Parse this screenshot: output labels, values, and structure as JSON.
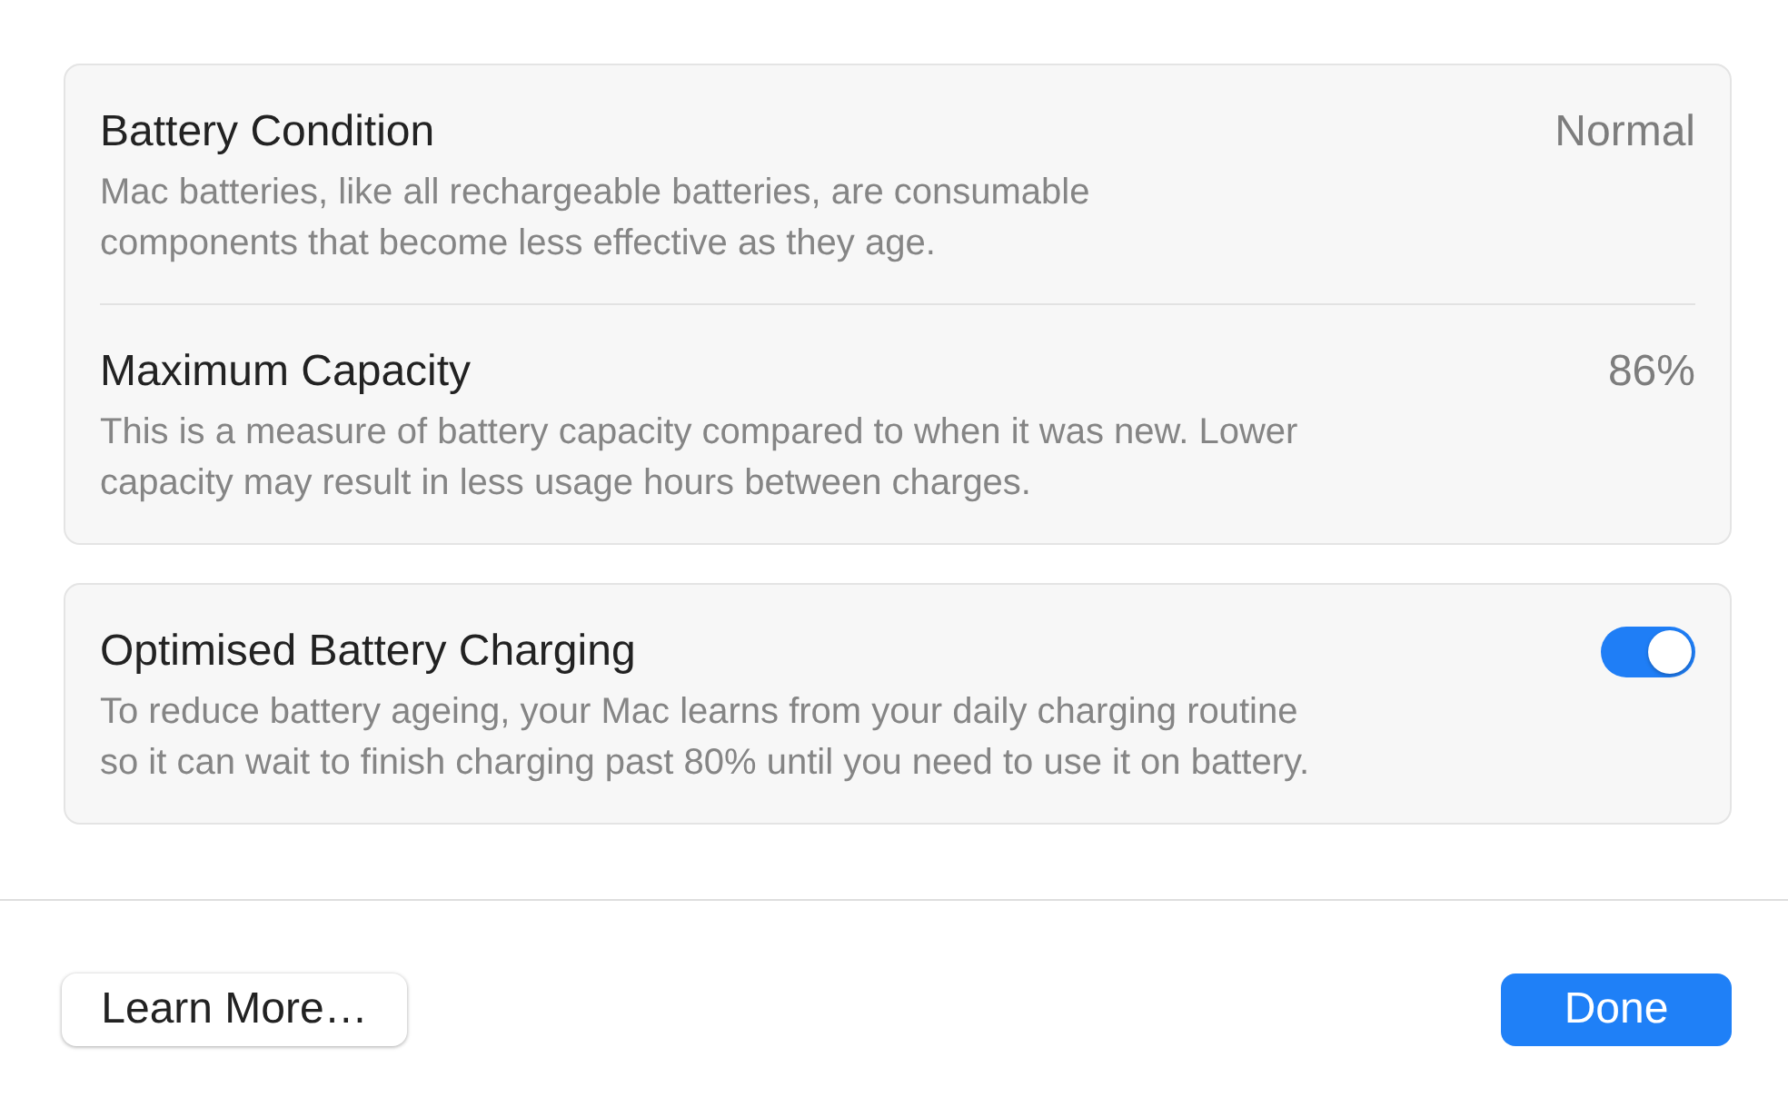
{
  "sections": [
    {
      "rows": [
        {
          "kind": "value",
          "title": "Battery Condition",
          "description": "Mac batteries, like all rechargeable batteries, are consumable\ncomponents that become less effective as they age.",
          "value": "Normal"
        },
        {
          "kind": "value",
          "title": "Maximum Capacity",
          "description": "This is a measure of battery capacity compared to when it was new. Lower\ncapacity may result in less usage hours between charges.",
          "value": "86%"
        }
      ]
    },
    {
      "rows": [
        {
          "kind": "toggle",
          "title": "Optimised Battery Charging",
          "description": "To reduce battery ageing, your Mac learns from your daily charging routine\nso it can wait to finish charging past 80% until you need to use it on battery.",
          "on": true
        }
      ]
    }
  ],
  "buttons": [
    {
      "kind": "secondary",
      "label": "Learn More…"
    },
    {
      "kind": "primary",
      "label": "Done"
    }
  ]
}
